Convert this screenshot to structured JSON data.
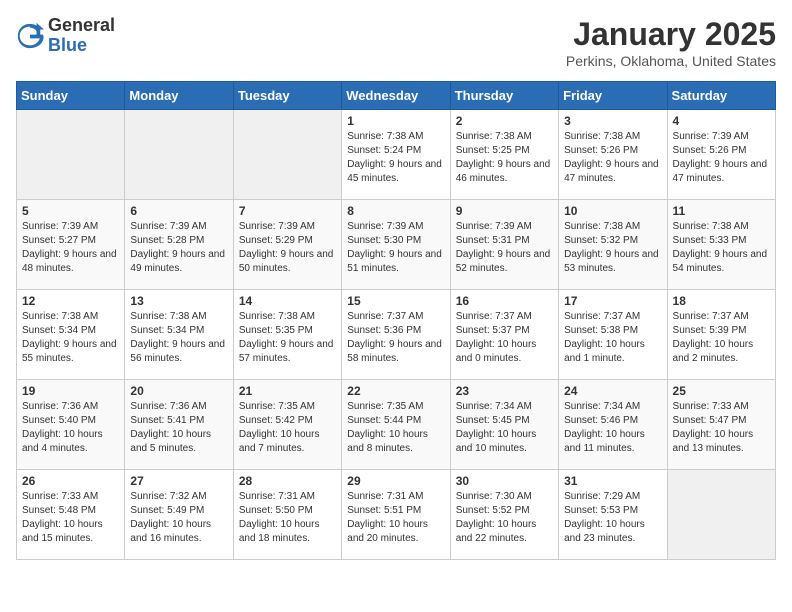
{
  "header": {
    "logo": {
      "general": "General",
      "blue": "Blue"
    },
    "title": "January 2025",
    "subtitle": "Perkins, Oklahoma, United States"
  },
  "calendar": {
    "days_of_week": [
      "Sunday",
      "Monday",
      "Tuesday",
      "Wednesday",
      "Thursday",
      "Friday",
      "Saturday"
    ],
    "weeks": [
      [
        {
          "day": "",
          "info": ""
        },
        {
          "day": "",
          "info": ""
        },
        {
          "day": "",
          "info": ""
        },
        {
          "day": "1",
          "info": "Sunrise: 7:38 AM\nSunset: 5:24 PM\nDaylight: 9 hours and 45 minutes."
        },
        {
          "day": "2",
          "info": "Sunrise: 7:38 AM\nSunset: 5:25 PM\nDaylight: 9 hours and 46 minutes."
        },
        {
          "day": "3",
          "info": "Sunrise: 7:38 AM\nSunset: 5:26 PM\nDaylight: 9 hours and 47 minutes."
        },
        {
          "day": "4",
          "info": "Sunrise: 7:39 AM\nSunset: 5:26 PM\nDaylight: 9 hours and 47 minutes."
        }
      ],
      [
        {
          "day": "5",
          "info": "Sunrise: 7:39 AM\nSunset: 5:27 PM\nDaylight: 9 hours and 48 minutes."
        },
        {
          "day": "6",
          "info": "Sunrise: 7:39 AM\nSunset: 5:28 PM\nDaylight: 9 hours and 49 minutes."
        },
        {
          "day": "7",
          "info": "Sunrise: 7:39 AM\nSunset: 5:29 PM\nDaylight: 9 hours and 50 minutes."
        },
        {
          "day": "8",
          "info": "Sunrise: 7:39 AM\nSunset: 5:30 PM\nDaylight: 9 hours and 51 minutes."
        },
        {
          "day": "9",
          "info": "Sunrise: 7:39 AM\nSunset: 5:31 PM\nDaylight: 9 hours and 52 minutes."
        },
        {
          "day": "10",
          "info": "Sunrise: 7:38 AM\nSunset: 5:32 PM\nDaylight: 9 hours and 53 minutes."
        },
        {
          "day": "11",
          "info": "Sunrise: 7:38 AM\nSunset: 5:33 PM\nDaylight: 9 hours and 54 minutes."
        }
      ],
      [
        {
          "day": "12",
          "info": "Sunrise: 7:38 AM\nSunset: 5:34 PM\nDaylight: 9 hours and 55 minutes."
        },
        {
          "day": "13",
          "info": "Sunrise: 7:38 AM\nSunset: 5:34 PM\nDaylight: 9 hours and 56 minutes."
        },
        {
          "day": "14",
          "info": "Sunrise: 7:38 AM\nSunset: 5:35 PM\nDaylight: 9 hours and 57 minutes."
        },
        {
          "day": "15",
          "info": "Sunrise: 7:37 AM\nSunset: 5:36 PM\nDaylight: 9 hours and 58 minutes."
        },
        {
          "day": "16",
          "info": "Sunrise: 7:37 AM\nSunset: 5:37 PM\nDaylight: 10 hours and 0 minutes."
        },
        {
          "day": "17",
          "info": "Sunrise: 7:37 AM\nSunset: 5:38 PM\nDaylight: 10 hours and 1 minute."
        },
        {
          "day": "18",
          "info": "Sunrise: 7:37 AM\nSunset: 5:39 PM\nDaylight: 10 hours and 2 minutes."
        }
      ],
      [
        {
          "day": "19",
          "info": "Sunrise: 7:36 AM\nSunset: 5:40 PM\nDaylight: 10 hours and 4 minutes."
        },
        {
          "day": "20",
          "info": "Sunrise: 7:36 AM\nSunset: 5:41 PM\nDaylight: 10 hours and 5 minutes."
        },
        {
          "day": "21",
          "info": "Sunrise: 7:35 AM\nSunset: 5:42 PM\nDaylight: 10 hours and 7 minutes."
        },
        {
          "day": "22",
          "info": "Sunrise: 7:35 AM\nSunset: 5:44 PM\nDaylight: 10 hours and 8 minutes."
        },
        {
          "day": "23",
          "info": "Sunrise: 7:34 AM\nSunset: 5:45 PM\nDaylight: 10 hours and 10 minutes."
        },
        {
          "day": "24",
          "info": "Sunrise: 7:34 AM\nSunset: 5:46 PM\nDaylight: 10 hours and 11 minutes."
        },
        {
          "day": "25",
          "info": "Sunrise: 7:33 AM\nSunset: 5:47 PM\nDaylight: 10 hours and 13 minutes."
        }
      ],
      [
        {
          "day": "26",
          "info": "Sunrise: 7:33 AM\nSunset: 5:48 PM\nDaylight: 10 hours and 15 minutes."
        },
        {
          "day": "27",
          "info": "Sunrise: 7:32 AM\nSunset: 5:49 PM\nDaylight: 10 hours and 16 minutes."
        },
        {
          "day": "28",
          "info": "Sunrise: 7:31 AM\nSunset: 5:50 PM\nDaylight: 10 hours and 18 minutes."
        },
        {
          "day": "29",
          "info": "Sunrise: 7:31 AM\nSunset: 5:51 PM\nDaylight: 10 hours and 20 minutes."
        },
        {
          "day": "30",
          "info": "Sunrise: 7:30 AM\nSunset: 5:52 PM\nDaylight: 10 hours and 22 minutes."
        },
        {
          "day": "31",
          "info": "Sunrise: 7:29 AM\nSunset: 5:53 PM\nDaylight: 10 hours and 23 minutes."
        },
        {
          "day": "",
          "info": ""
        }
      ]
    ]
  }
}
